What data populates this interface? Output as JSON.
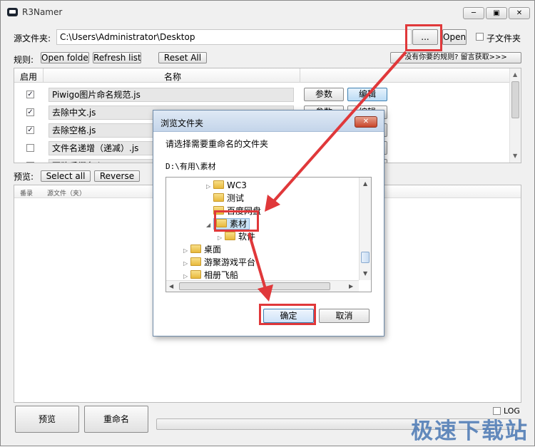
{
  "window": {
    "title": "R3Namer"
  },
  "source": {
    "label": "源文件夹:",
    "path": "C:\\Users\\Administrator\\Desktop",
    "browse_label": "...",
    "open_label": "Open",
    "subfolder_label": "子文件夹"
  },
  "rules": {
    "label": "规则:",
    "open_folder": "Open folder",
    "refresh_list": "Refresh list",
    "reset_all": "Reset All",
    "get_more": "没有你要的规则? 留言获取>>>",
    "col_enable": "启用",
    "col_name": "名称",
    "params_label": "参数",
    "edit_label": "编辑",
    "items": [
      {
        "name": "Piwigo图片命名规范.js",
        "checked": true
      },
      {
        "name": "去除中文.js",
        "checked": true
      },
      {
        "name": "去除空格.js",
        "checked": true
      },
      {
        "name": "文件名递增（递减）.js",
        "checked": false
      },
      {
        "name": "更改后缀名.js",
        "checked": false
      }
    ]
  },
  "preview": {
    "label": "预览:",
    "select_all": "Select all",
    "reverse": "Reverse",
    "col_index": "番录",
    "col_source": "源文件（夹）"
  },
  "bottom": {
    "preview_button": "预览",
    "rename_button": "重命名",
    "log_label": "LOG"
  },
  "dialog": {
    "title": "浏览文件夹",
    "prompt": "请选择需要重命名的文件夹",
    "path": "D:\\有用\\素材",
    "tree": [
      {
        "label": "WC3",
        "indent": 4,
        "arrow": "▷"
      },
      {
        "label": "测试",
        "indent": 4,
        "arrow": ""
      },
      {
        "label": "百度网盘",
        "indent": 4,
        "arrow": ""
      },
      {
        "label": "素材",
        "indent": 4,
        "arrow": "◢",
        "selected": true
      },
      {
        "label": "软件",
        "indent": 5,
        "arrow": "▷"
      },
      {
        "label": "桌面",
        "indent": 2,
        "arrow": "▷"
      },
      {
        "label": "游聚游戏平台",
        "indent": 2,
        "arrow": "▷"
      },
      {
        "label": "相册飞船",
        "indent": 2,
        "arrow": "▷"
      }
    ],
    "ok_label": "确定",
    "cancel_label": "取消"
  },
  "watermark": "极速下载站"
}
